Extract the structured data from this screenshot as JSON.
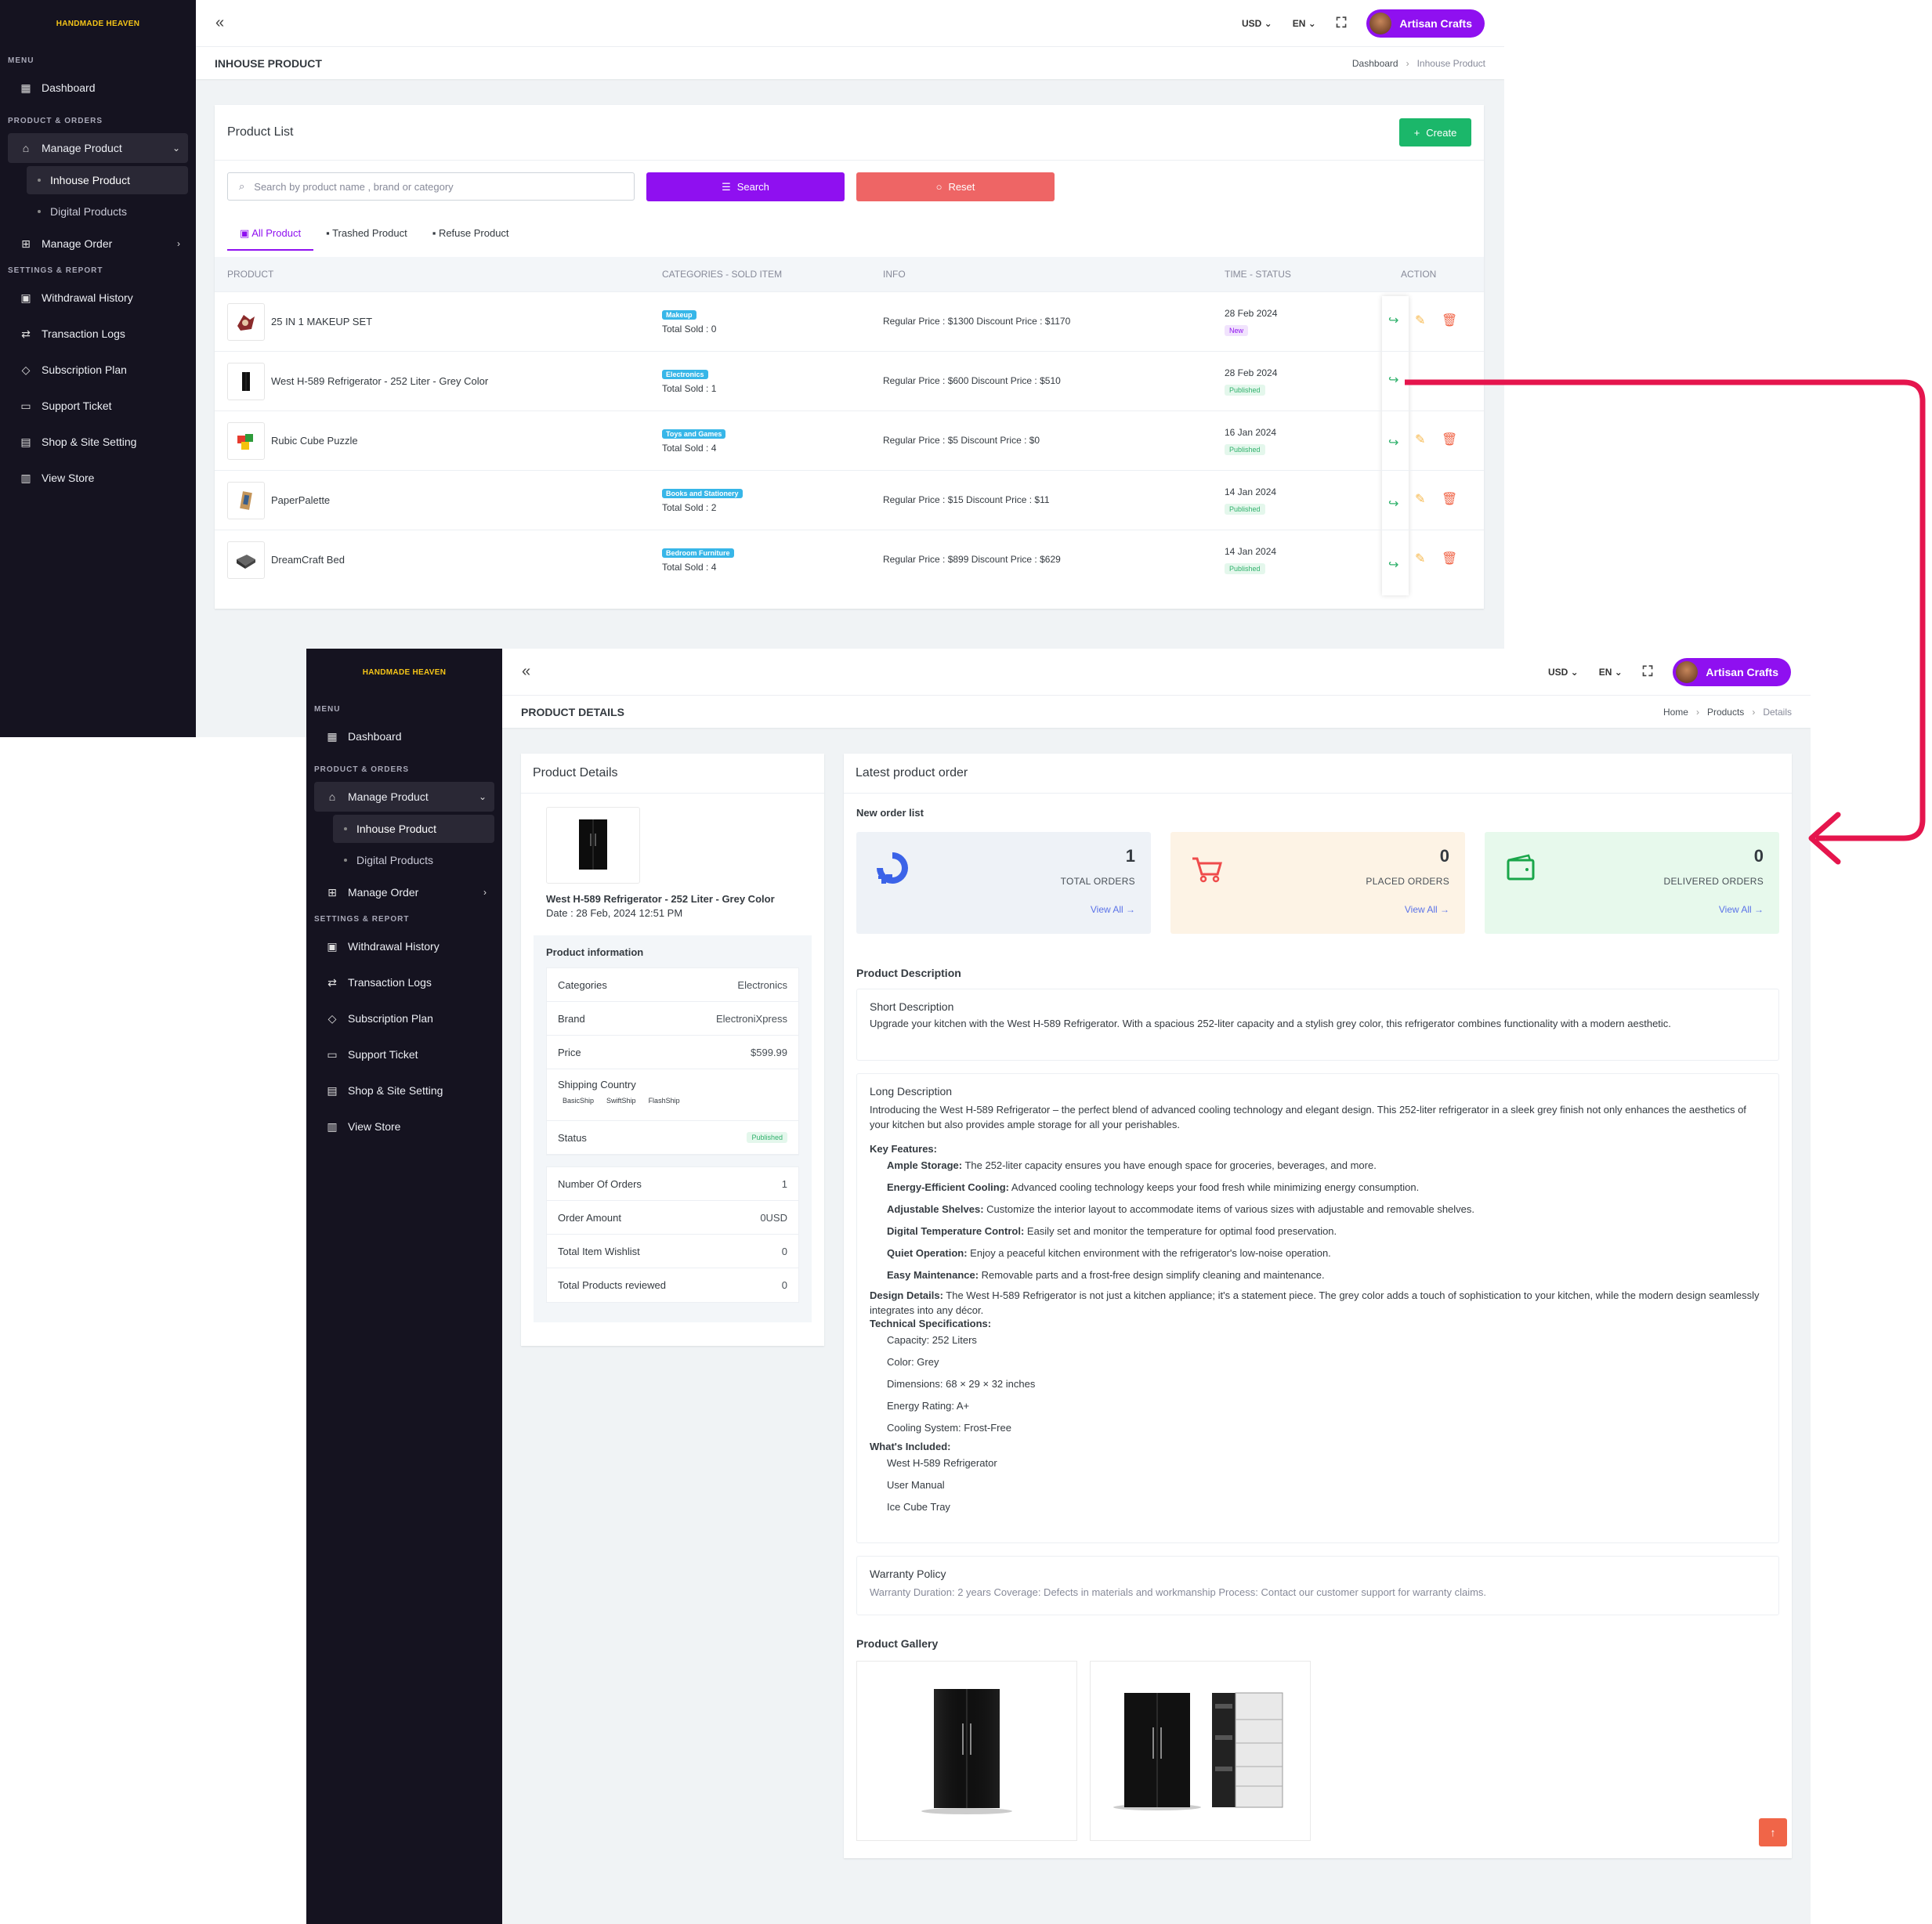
{
  "brand": "HANDMADE HEAVEN",
  "sidebar": {
    "menu_title": "MENU",
    "dashboard": "Dashboard",
    "section_product": "PRODUCT & ORDERS",
    "manage_product": "Manage Product",
    "inhouse_product": "Inhouse Product",
    "digital_products": "Digital Products",
    "manage_order": "Manage Order",
    "section_settings": "SETTINGS & REPORT",
    "withdrawal_history": "Withdrawal History",
    "transaction_logs": "Transaction Logs",
    "subscription_plan": "Subscription Plan",
    "support_ticket": "Support Ticket",
    "shop_site_setting": "Shop & Site Setting",
    "view_store": "View Store"
  },
  "topbar": {
    "currency": "USD",
    "language": "EN",
    "user_name": "Artisan Crafts"
  },
  "list_page": {
    "title": "INHOUSE PRODUCT",
    "breadcrumb": [
      "Dashboard",
      "Inhouse Product"
    ],
    "card_title": "Product List",
    "create_label": "Create",
    "search_placeholder": "Search  by product name , brand or category",
    "search_label": "Search",
    "reset_label": "Reset",
    "tabs": [
      "All Product",
      "Trashed Product",
      "Refuse Product"
    ],
    "columns": [
      "PRODUCT",
      "CATEGORIES - SOLD ITEM",
      "INFO",
      "TIME - STATUS",
      "ACTION"
    ],
    "rows": [
      {
        "name": "25 IN 1 MAKEUP SET",
        "category": "Makeup",
        "sold": "Total Sold : 0",
        "info": "Regular Price : $1300 Discount Price : $1170",
        "date": "28 Feb 2024",
        "status": "New"
      },
      {
        "name": "West H-589 Refrigerator - 252 Liter - Grey Color",
        "category": "Electronics",
        "sold": "Total Sold : 1",
        "info": "Regular Price : $600 Discount Price : $510",
        "date": "28 Feb 2024",
        "status": "Published"
      },
      {
        "name": "Rubic Cube Puzzle",
        "category": "Toys and Games",
        "sold": "Total Sold : 4",
        "info": "Regular Price : $5 Discount Price : $0",
        "date": "16 Jan 2024",
        "status": "Published"
      },
      {
        "name": "PaperPalette",
        "category": "Books and Stationery",
        "sold": "Total Sold : 2",
        "info": "Regular Price : $15 Discount Price : $11",
        "date": "14 Jan 2024",
        "status": "Published"
      },
      {
        "name": "DreamCraft Bed",
        "category": "Bedroom Furniture",
        "sold": "Total Sold : 4",
        "info": "Regular Price : $899 Discount Price : $629",
        "date": "14 Jan 2024",
        "status": "Published"
      }
    ]
  },
  "details_page": {
    "title": "PRODUCT DETAILS",
    "breadcrumb": [
      "Home",
      "Products",
      "Details"
    ],
    "card_title": "Product Details",
    "product_name": "West H-589 Refrigerator - 252 Liter - Grey Color",
    "product_date": "Date : 28 Feb, 2024 12:51 PM",
    "info_title": "Product information",
    "categories_label": "Categories",
    "categories_value": "Electronics",
    "brand_label": "Brand",
    "brand_value": "ElectroniXpress",
    "price_label": "Price",
    "price_value": "$599.99",
    "shipping_label": "Shipping Country",
    "shipping": [
      "BasicShip",
      "SwiftShip",
      "FlashShip"
    ],
    "status_label": "Status",
    "status_value": "Published",
    "orders_label": "Number Of Orders",
    "orders_value": "1",
    "amount_label": "Order Amount",
    "amount_value": "0USD",
    "wishlist_label": "Total Item Wishlist",
    "wishlist_value": "0",
    "reviewed_label": "Total Products reviewed",
    "reviewed_value": "0",
    "latest_title": "Latest product order",
    "new_order_list": "New order list",
    "stats": [
      {
        "value": "1",
        "label": "TOTAL ORDERS",
        "link": "View All →"
      },
      {
        "value": "0",
        "label": "PLACED ORDERS",
        "link": "View All →"
      },
      {
        "value": "0",
        "label": "DELIVERED ORDERS",
        "link": "View All →"
      }
    ],
    "desc_title": "Product Description",
    "short_title": "Short Description",
    "short_text": "Upgrade your kitchen with the West H-589 Refrigerator. With a spacious 252-liter capacity and a stylish grey color, this refrigerator combines functionality with a modern aesthetic.",
    "long_title": "Long Description",
    "long_intro": "Introducing the West H-589 Refrigerator – the perfect blend of advanced cooling technology and elegant design. This 252-liter refrigerator in a sleek grey finish not only enhances the aesthetics of your kitchen but also provides ample storage for all your perishables.",
    "key_features_title": "Key Features:",
    "key_features": [
      {
        "k": "Ample Storage:",
        "v": " The 252-liter capacity ensures you have enough space for groceries, beverages, and more."
      },
      {
        "k": "Energy-Efficient Cooling:",
        "v": " Advanced cooling technology keeps your food fresh while minimizing energy consumption."
      },
      {
        "k": "Adjustable Shelves:",
        "v": " Customize the interior layout to accommodate items of various sizes with adjustable and removable shelves."
      },
      {
        "k": "Digital Temperature Control:",
        "v": " Easily set and monitor the temperature for optimal food preservation."
      },
      {
        "k": "Quiet Operation:",
        "v": " Enjoy a peaceful kitchen environment with the refrigerator's low-noise operation."
      },
      {
        "k": "Easy Maintenance:",
        "v": " Removable parts and a frost-free design simplify cleaning and maintenance."
      }
    ],
    "design_title": "Design Details:",
    "design_text": " The West H-589 Refrigerator is not just a kitchen appliance; it's a statement piece. The grey color adds a touch of sophistication to your kitchen, while the modern design seamlessly integrates into any décor.",
    "tech_title": "Technical Specifications:",
    "tech": [
      "Capacity: 252 Liters",
      "Color: Grey",
      "Dimensions: 68 × 29 × 32 inches",
      "Energy Rating: A+",
      "Cooling System: Frost-Free"
    ],
    "included_title": "What's Included:",
    "included": [
      "West H-589 Refrigerator",
      "User Manual",
      "Ice Cube Tray"
    ],
    "warranty_title": "Warranty Policy",
    "warranty_text": "Warranty Duration: 2 years Coverage: Defects in materials and workmanship Process: Contact our customer support for warranty claims.",
    "gallery_title": "Product Gallery"
  },
  "colors": {
    "primary": "#8f10f0",
    "success": "#0ab39c",
    "danger": "#f06548",
    "sidebar": "#151320",
    "arrow": "#e5154d"
  }
}
